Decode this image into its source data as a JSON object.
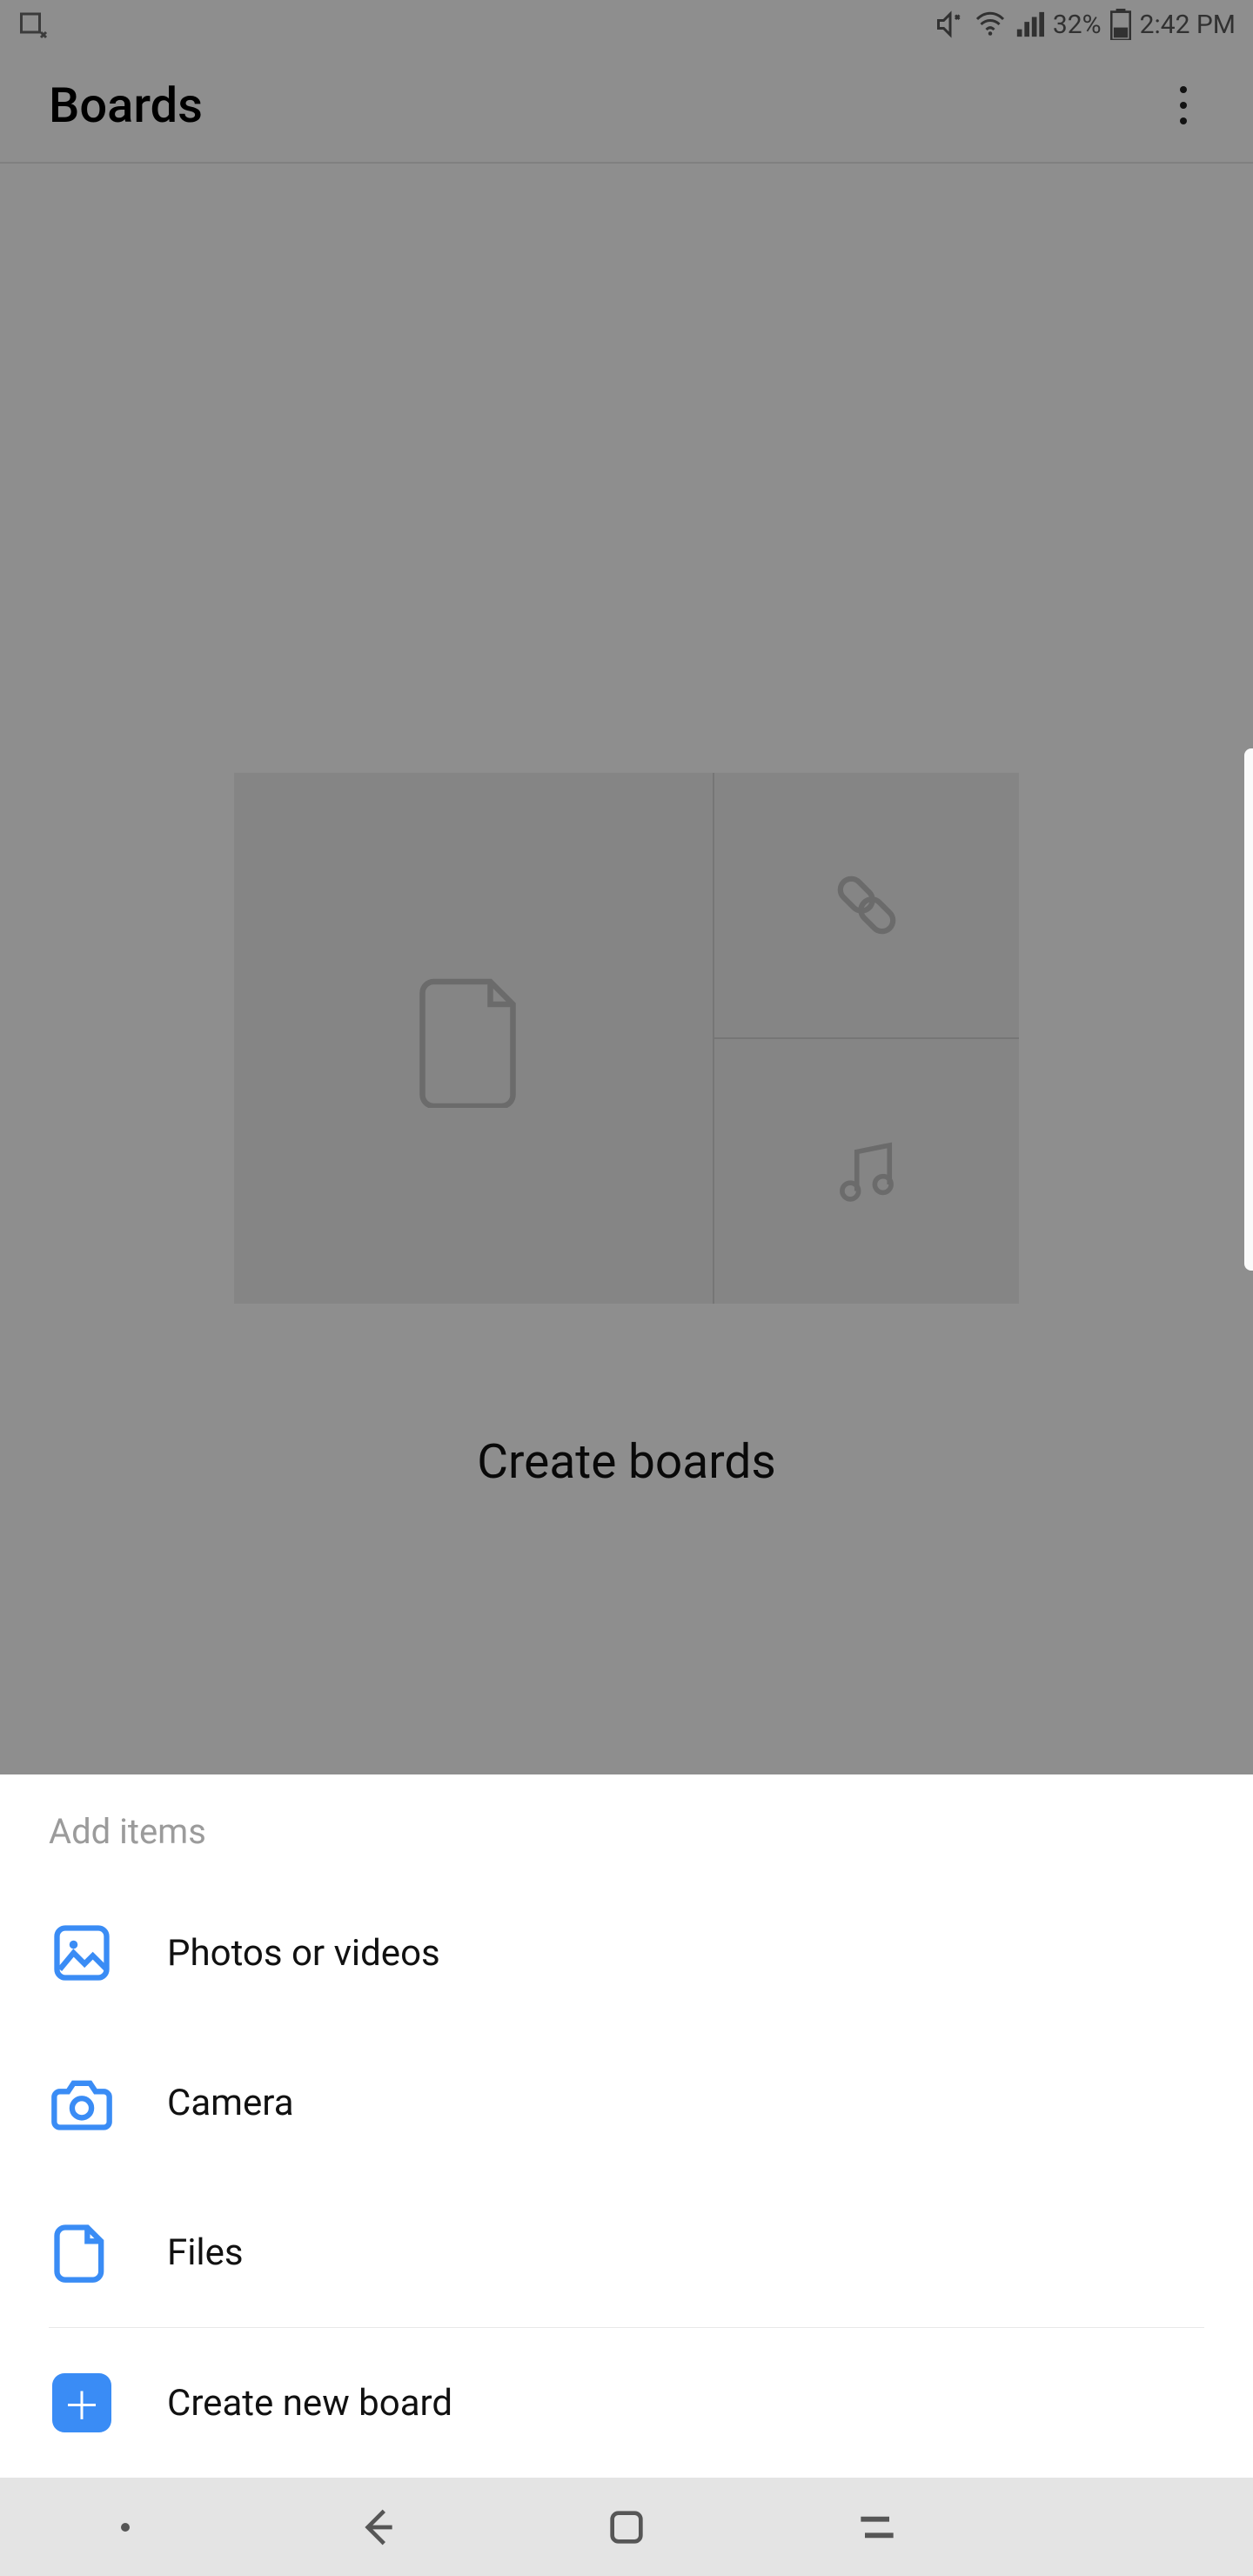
{
  "status": {
    "battery": "32%",
    "time": "2:42 PM"
  },
  "header": {
    "title": "Boards"
  },
  "empty": {
    "heading": "Create boards"
  },
  "sheet": {
    "title": "Add items",
    "items": {
      "photos": "Photos or videos",
      "camera": "Camera",
      "files": "Files",
      "create": "Create new board"
    }
  }
}
